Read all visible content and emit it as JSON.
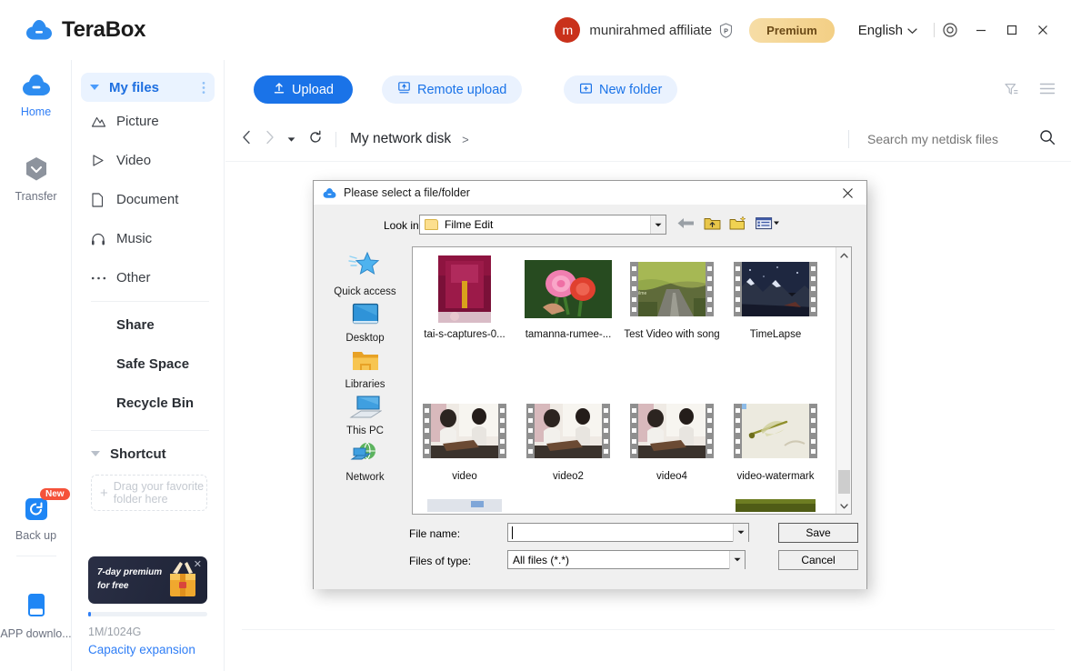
{
  "app": {
    "brand": "TeraBox",
    "logo_icon": "terabox-cloud-logo",
    "accent": "#1a73e8"
  },
  "header": {
    "avatar_letter": "m",
    "username": "munirahmed affiliate",
    "premium_badge_icon": "premium-p-badge",
    "premium_label": "Premium",
    "language": "English",
    "language_caret_icon": "chevron-down-icon",
    "settings_icon": "gear-icon",
    "minimize_icon": "minimize-icon",
    "maximize_icon": "maximize-icon",
    "close_icon": "close-icon"
  },
  "rail": {
    "items": [
      {
        "label": "Home",
        "icon": "cloud-icon",
        "active": true
      },
      {
        "label": "Transfer",
        "icon": "transfer-icon",
        "active": false
      },
      {
        "label": "Back up",
        "icon": "backup-icon",
        "active": false,
        "badge": "New"
      },
      {
        "label": "APP downlo...",
        "icon": "app-download-icon",
        "active": false
      }
    ]
  },
  "sidebar": {
    "my_files": {
      "label": "My files",
      "caret_icon": "caret-down-icon",
      "menu_icon": "kebab-menu-icon"
    },
    "categories": [
      {
        "label": "Picture",
        "icon": "picture-icon"
      },
      {
        "label": "Video",
        "icon": "video-icon"
      },
      {
        "label": "Document",
        "icon": "document-icon"
      },
      {
        "label": "Music",
        "icon": "music-icon"
      },
      {
        "label": "Other",
        "icon": "other-icon"
      }
    ],
    "links": [
      {
        "label": "Share"
      },
      {
        "label": "Safe Space"
      },
      {
        "label": "Recycle Bin"
      }
    ],
    "shortcut": {
      "label": "Shortcut",
      "caret_icon": "caret-down-icon",
      "dropzone_line1": "Drag your favorite",
      "dropzone_line2": "folder here",
      "dropzone_plus_icon": "plus-icon"
    },
    "promo": {
      "line1": "7-day premium",
      "line2": "for free",
      "close_icon": "close-icon",
      "gift_icon": "gift-box-icon"
    },
    "capacity": {
      "text": "1M/1024G",
      "link": "Capacity expansion",
      "percent": 3
    }
  },
  "main": {
    "toolbar": {
      "upload": {
        "label": "Upload",
        "icon": "upload-icon"
      },
      "remote_upload": {
        "label": "Remote upload",
        "icon": "remote-upload-icon"
      },
      "new_folder": {
        "label": "New folder",
        "icon": "new-folder-icon"
      },
      "filter_icon": "filter-icon",
      "list_view_icon": "list-view-icon"
    },
    "breadcrumb": {
      "back_icon": "chevron-left-icon",
      "forward_icon": "chevron-right-icon",
      "history_caret_icon": "caret-down-icon",
      "refresh_icon": "refresh-icon",
      "path": "My network disk",
      "path_arrow": ">"
    },
    "search": {
      "placeholder": "Search my netdisk files",
      "value": "",
      "icon": "search-icon"
    }
  },
  "dialog": {
    "title": "Please select a file/folder",
    "title_icon": "terabox-cloud-logo",
    "close_icon": "close-icon",
    "look_in": {
      "label": "Look in:",
      "value": "Filme Edit",
      "folder_icon": "folder-icon",
      "dropdown_icon": "dropdown-arrow-icon"
    },
    "tool_icons": [
      {
        "name": "back-arrow-icon"
      },
      {
        "name": "up-one-level-icon"
      },
      {
        "name": "create-new-folder-icon"
      },
      {
        "name": "views-icon"
      }
    ],
    "places": [
      {
        "label": "Quick access",
        "icon": "quick-access-star-icon"
      },
      {
        "label": "Desktop",
        "icon": "desktop-icon"
      },
      {
        "label": "Libraries",
        "icon": "libraries-folder-icon"
      },
      {
        "label": "This PC",
        "icon": "this-pc-icon"
      },
      {
        "label": "Network",
        "icon": "network-icon"
      }
    ],
    "files": [
      {
        "name": "tai-s-captures-0...",
        "kind": "image",
        "thumb": "graduation-cap-photo"
      },
      {
        "name": "tamanna-rumee-...",
        "kind": "image",
        "thumb": "pink-roses-photo"
      },
      {
        "name": "Test Video with song",
        "kind": "video",
        "thumb": "autumn-road-video"
      },
      {
        "name": "TimeLapse",
        "kind": "video",
        "thumb": "mountain-night-video"
      },
      {
        "name": "video",
        "kind": "video",
        "thumb": "students-desk-video"
      },
      {
        "name": "video2",
        "kind": "video",
        "thumb": "students-desk-video"
      },
      {
        "name": "video4",
        "kind": "video",
        "thumb": "students-desk-video"
      },
      {
        "name": "video-watermark",
        "kind": "video",
        "thumb": "dragonfly-watermark-video"
      }
    ],
    "scrollbar": {
      "up_icon": "scroll-up-icon",
      "down_icon": "scroll-down-icon"
    },
    "file_name": {
      "label": "File name:",
      "value": ""
    },
    "files_of_type": {
      "label": "Files of type:",
      "value": "All files (*.*)"
    },
    "buttons": {
      "save": "Save",
      "cancel": "Cancel"
    }
  }
}
